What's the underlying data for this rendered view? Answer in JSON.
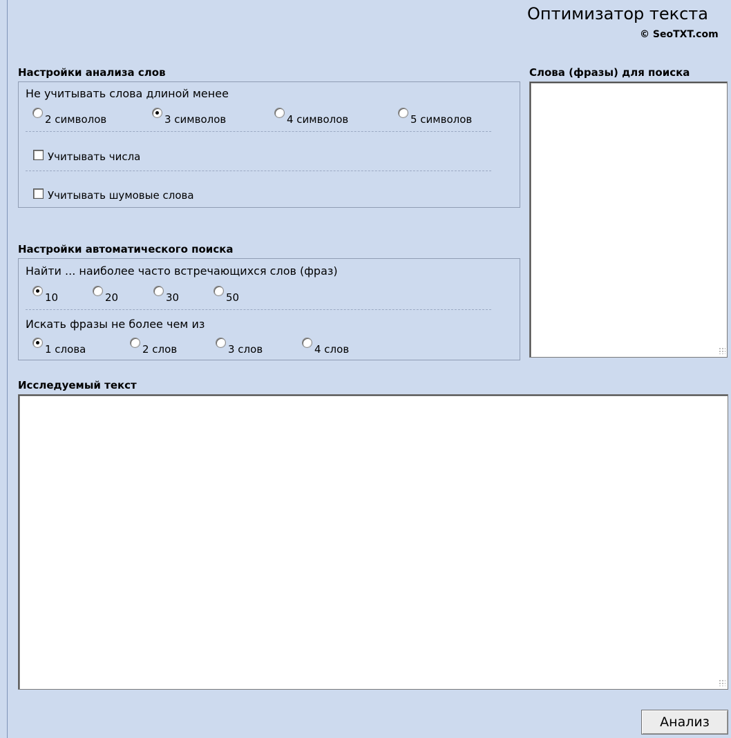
{
  "header": {
    "title": "Оптимизатор текста",
    "copyright": "© SeoTXT.com"
  },
  "word_analysis": {
    "title": "Настройки анализа слов",
    "min_length_label": "Не учитывать слова длиной менее",
    "min_length_options": [
      {
        "label": "2 символов",
        "checked": false
      },
      {
        "label": "3 символов",
        "checked": true
      },
      {
        "label": "4 символов",
        "checked": false
      },
      {
        "label": "5 символов",
        "checked": false
      }
    ],
    "count_numbers_label": "Учитывать числа",
    "count_numbers_checked": false,
    "noise_words_label": "Учитывать шумовые слова",
    "noise_words_checked": false
  },
  "auto_search": {
    "title": "Настройки автоматического поиска",
    "find_label": "Найти ... наиболее часто встречающихся слов (фраз)",
    "find_options": [
      {
        "label": "10",
        "checked": true
      },
      {
        "label": "20",
        "checked": false
      },
      {
        "label": "30",
        "checked": false
      },
      {
        "label": "50",
        "checked": false
      }
    ],
    "phrase_label": "Искать фразы не более чем из",
    "phrase_options": [
      {
        "label": "1 слова",
        "checked": true
      },
      {
        "label": "2 слов",
        "checked": false
      },
      {
        "label": "3 слов",
        "checked": false
      },
      {
        "label": "4 слов",
        "checked": false
      }
    ]
  },
  "search_words": {
    "title": "Слова (фразы) для поиска",
    "value": ""
  },
  "text_under_study": {
    "title": "Исследуемый текст",
    "value": ""
  },
  "actions": {
    "analyze_label": "Анализ"
  }
}
